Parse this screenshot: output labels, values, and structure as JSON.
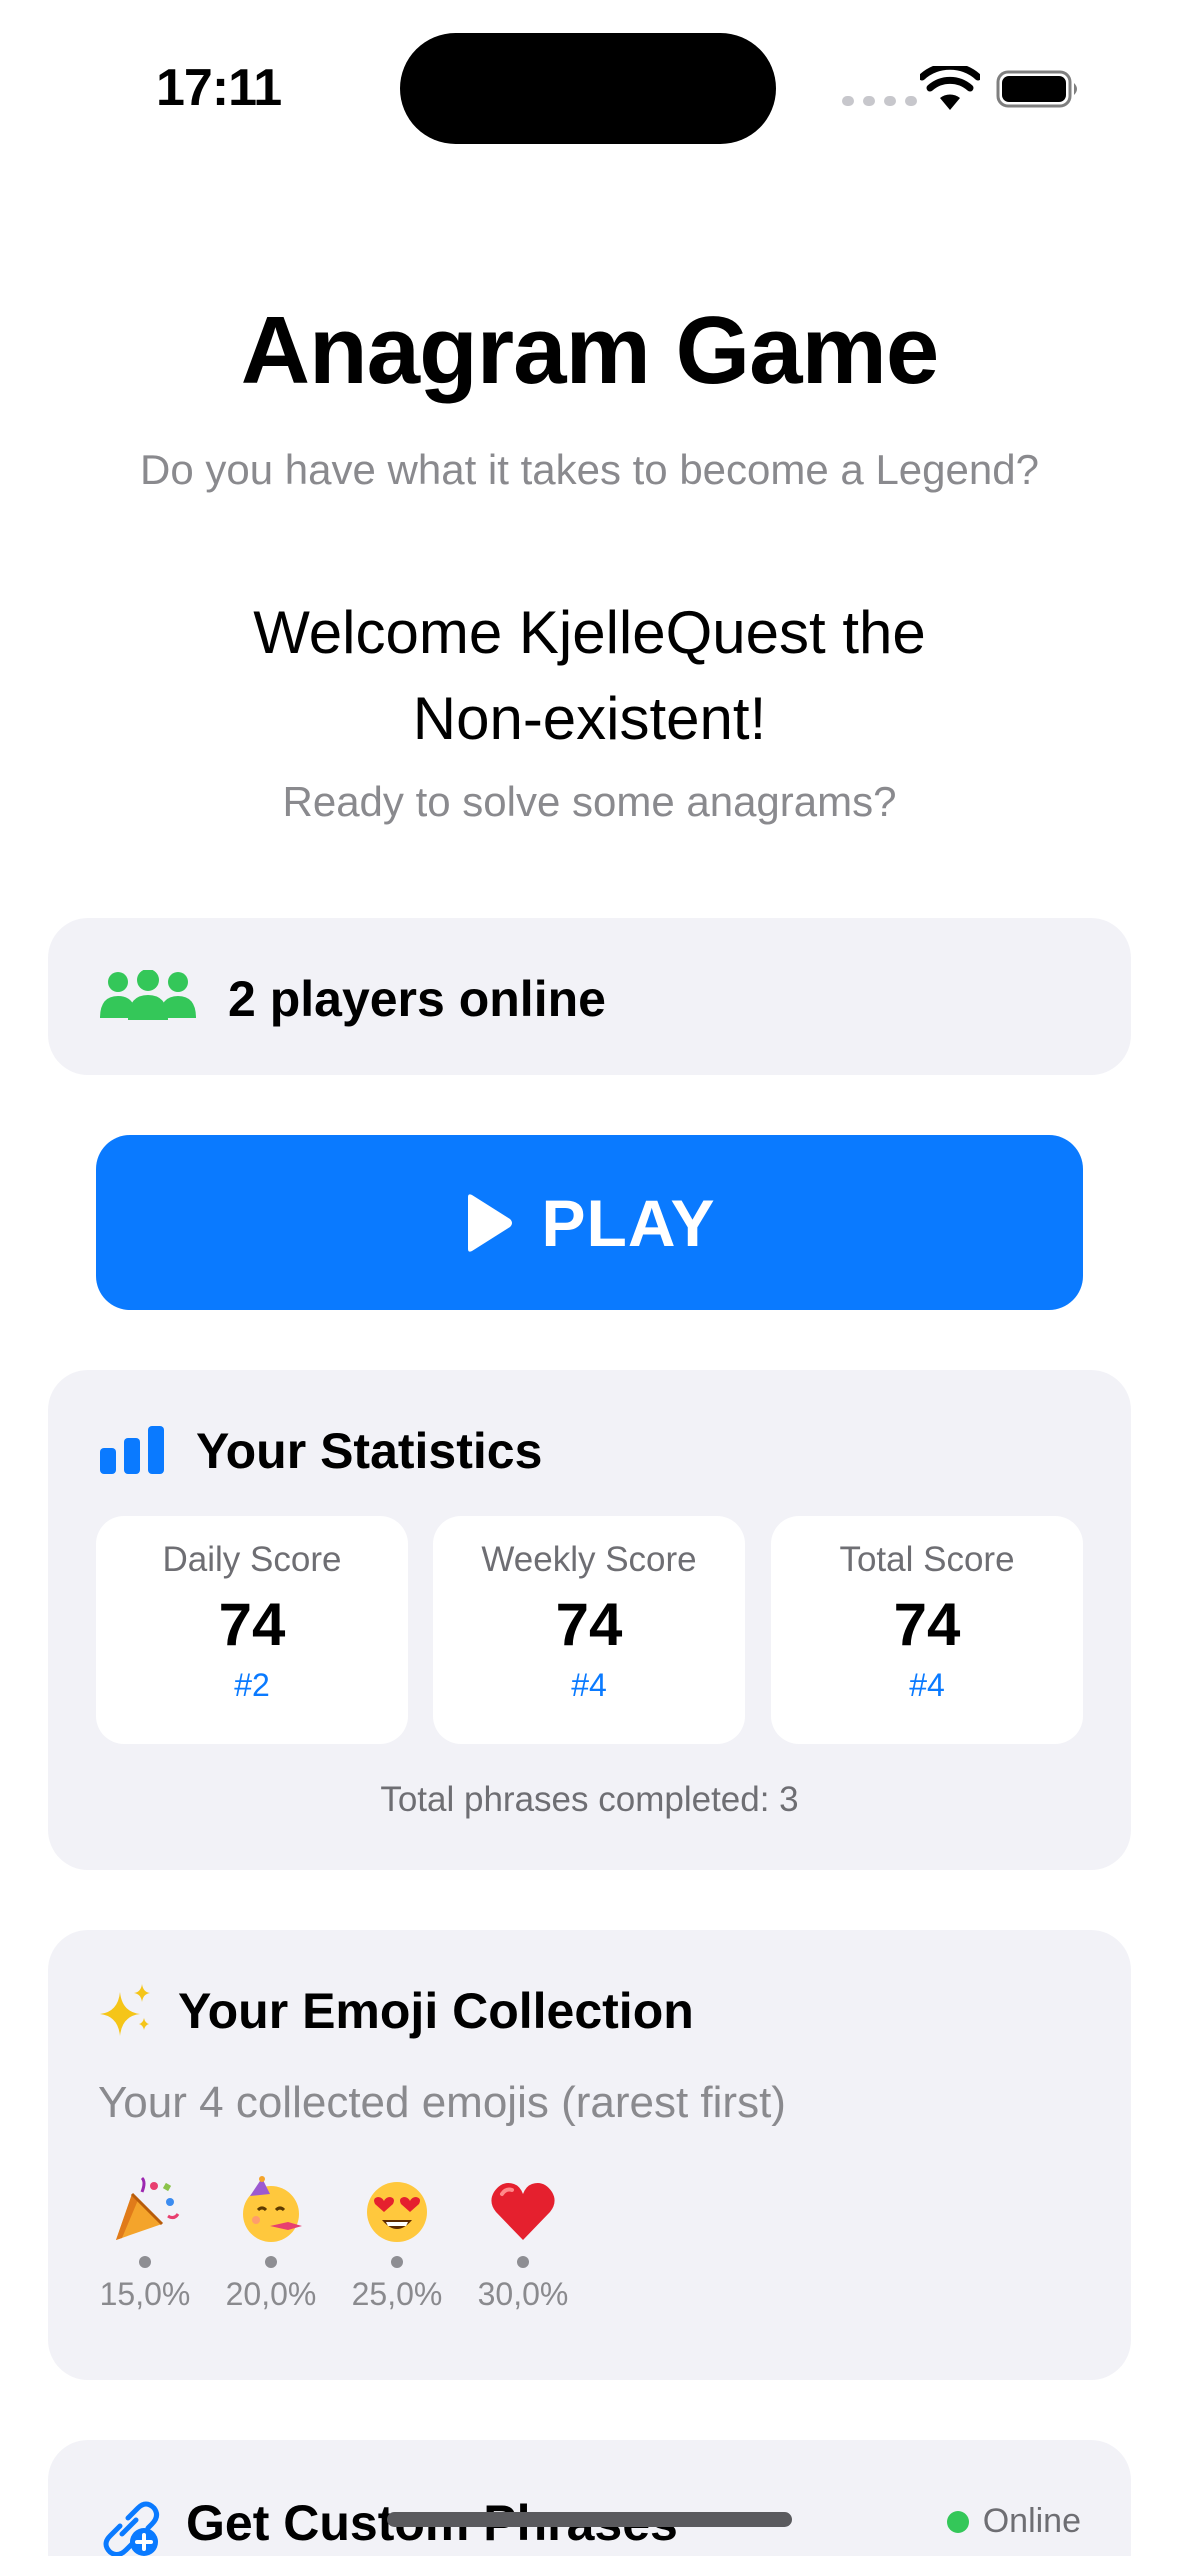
{
  "status_bar": {
    "time": "17:11"
  },
  "header": {
    "title": "Anagram Game",
    "subtitle": "Do you have what it takes to become a Legend?"
  },
  "welcome": {
    "line1": "Welcome KjelleQuest the",
    "line2": "Non-existent!",
    "prompt": "Ready to solve some anagrams?"
  },
  "online": {
    "text": "2 players online",
    "icon": "people-icon",
    "color": "#34c759"
  },
  "play": {
    "label": "PLAY",
    "color": "#0a7aff"
  },
  "stats": {
    "title": "Your Statistics",
    "items": [
      {
        "label": "Daily Score",
        "value": "74",
        "rank": "#2"
      },
      {
        "label": "Weekly Score",
        "value": "74",
        "rank": "#4"
      },
      {
        "label": "Total Score",
        "value": "74",
        "rank": "#4"
      }
    ],
    "footer": "Total phrases completed: 3"
  },
  "emojis": {
    "title": "Your Emoji Collection",
    "subtitle": "Your 4 collected emojis (rarest first)",
    "items": [
      {
        "icon": "party-popper-icon",
        "percent": "15,0%"
      },
      {
        "icon": "partying-face-icon",
        "percent": "20,0%"
      },
      {
        "icon": "heart-eyes-face-icon",
        "percent": "25,0%"
      },
      {
        "icon": "red-heart-icon",
        "percent": "30,0%"
      }
    ]
  },
  "phrases": {
    "title": "Get Custom Phrases",
    "status": "Online"
  }
}
